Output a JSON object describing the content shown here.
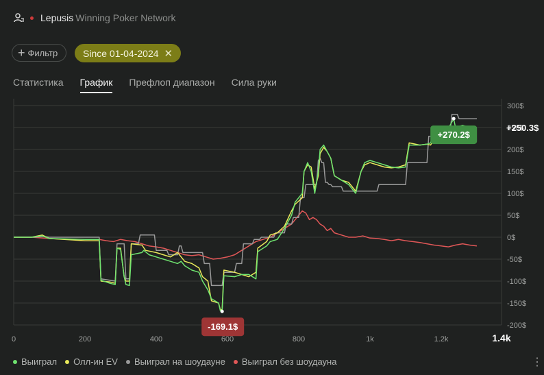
{
  "header": {
    "player": "Lepusis",
    "network": "Winning Poker Network"
  },
  "filter": {
    "add_label": "Фильтр",
    "date_chip": "Since 01-04-2024"
  },
  "tabs": [
    {
      "label": "Статистика"
    },
    {
      "label": "График"
    },
    {
      "label": "Префлоп диапазон"
    },
    {
      "label": "Сила руки"
    }
  ],
  "colors": {
    "won": "#6fe36f",
    "allin_ev": "#e8e85a",
    "showdown": "#9a9a9a",
    "non_showdown": "#e05757",
    "positive_badge": "#3f8f43",
    "negative_badge": "#9e3535"
  },
  "icons": {
    "player": "user-switch-icon",
    "more": "vertical-dots-icon"
  },
  "chart_data": {
    "type": "line",
    "xlim": [
      0,
      1400
    ],
    "ylim": [
      -200,
      300
    ],
    "x_ticks": [
      "0",
      "200",
      "400",
      "600",
      "800",
      "1k",
      "1.2k",
      "1.4k"
    ],
    "y_ticks": [
      "300$",
      "250$",
      "200$",
      "150$",
      "100$",
      "50$",
      "0$",
      "-50$",
      "-100$",
      "-150$",
      "-200$"
    ],
    "annotations": {
      "max_label": "+270.2$",
      "min_label": "-169.1$",
      "final_label": "+250.3$"
    },
    "series": [
      {
        "name": "Выиграл",
        "key": "won",
        "points": [
          [
            0,
            0
          ],
          [
            50,
            0
          ],
          [
            80,
            3
          ],
          [
            100,
            -3
          ],
          [
            200,
            -5
          ],
          [
            240,
            -5
          ],
          [
            245,
            -98
          ],
          [
            270,
            -105
          ],
          [
            285,
            -108
          ],
          [
            290,
            -25
          ],
          [
            300,
            -28
          ],
          [
            310,
            -90
          ],
          [
            315,
            -108
          ],
          [
            325,
            -110
          ],
          [
            330,
            -40
          ],
          [
            360,
            -35
          ],
          [
            365,
            -30
          ],
          [
            380,
            -40
          ],
          [
            400,
            -45
          ],
          [
            420,
            -50
          ],
          [
            440,
            -55
          ],
          [
            460,
            -60
          ],
          [
            470,
            -55
          ],
          [
            480,
            -65
          ],
          [
            500,
            -75
          ],
          [
            520,
            -80
          ],
          [
            530,
            -100
          ],
          [
            545,
            -120
          ],
          [
            555,
            -140
          ],
          [
            575,
            -150
          ],
          [
            580,
            -168
          ],
          [
            585,
            -169
          ],
          [
            590,
            -88
          ],
          [
            620,
            -90
          ],
          [
            640,
            -85
          ],
          [
            660,
            -85
          ],
          [
            680,
            -95
          ],
          [
            685,
            -33
          ],
          [
            710,
            -20
          ],
          [
            720,
            -10
          ],
          [
            740,
            -5
          ],
          [
            760,
            20
          ],
          [
            780,
            50
          ],
          [
            790,
            80
          ],
          [
            810,
            100
          ],
          [
            815,
            150
          ],
          [
            825,
            170
          ],
          [
            835,
            150
          ],
          [
            845,
            100
          ],
          [
            855,
            150
          ],
          [
            860,
            200
          ],
          [
            870,
            210
          ],
          [
            880,
            195
          ],
          [
            890,
            180
          ],
          [
            900,
            140
          ],
          [
            920,
            130
          ],
          [
            940,
            120
          ],
          [
            950,
            110
          ],
          [
            960,
            100
          ],
          [
            975,
            150
          ],
          [
            985,
            170
          ],
          [
            1000,
            175
          ],
          [
            1020,
            170
          ],
          [
            1040,
            165
          ],
          [
            1060,
            160
          ],
          [
            1080,
            158
          ],
          [
            1100,
            160
          ],
          [
            1110,
            210
          ],
          [
            1140,
            210
          ],
          [
            1160,
            212
          ],
          [
            1170,
            215
          ],
          [
            1180,
            240
          ],
          [
            1200,
            245
          ],
          [
            1220,
            248
          ],
          [
            1235,
            270
          ],
          [
            1240,
            250
          ],
          [
            1260,
            255
          ],
          [
            1280,
            250
          ],
          [
            1300,
            250
          ]
        ]
      },
      {
        "name": "Олл-ин EV",
        "key": "allin_ev",
        "points": [
          [
            0,
            0
          ],
          [
            50,
            0
          ],
          [
            80,
            5
          ],
          [
            100,
            -3
          ],
          [
            200,
            -8
          ],
          [
            240,
            -8
          ],
          [
            245,
            -100
          ],
          [
            270,
            -102
          ],
          [
            285,
            -105
          ],
          [
            290,
            -25
          ],
          [
            300,
            -25
          ],
          [
            310,
            -90
          ],
          [
            315,
            -100
          ],
          [
            325,
            -100
          ],
          [
            330,
            -15
          ],
          [
            360,
            -18
          ],
          [
            370,
            -30
          ],
          [
            400,
            -35
          ],
          [
            420,
            -40
          ],
          [
            440,
            -45
          ],
          [
            460,
            -35
          ],
          [
            480,
            -55
          ],
          [
            500,
            -60
          ],
          [
            520,
            -70
          ],
          [
            530,
            -90
          ],
          [
            545,
            -100
          ],
          [
            555,
            -145
          ],
          [
            575,
            -150
          ],
          [
            580,
            -165
          ],
          [
            585,
            -165
          ],
          [
            590,
            -75
          ],
          [
            620,
            -80
          ],
          [
            640,
            -85
          ],
          [
            660,
            -90
          ],
          [
            680,
            -80
          ],
          [
            685,
            -25
          ],
          [
            710,
            -10
          ],
          [
            720,
            5
          ],
          [
            740,
            10
          ],
          [
            760,
            25
          ],
          [
            780,
            60
          ],
          [
            790,
            75
          ],
          [
            810,
            90
          ],
          [
            815,
            150
          ],
          [
            825,
            165
          ],
          [
            835,
            160
          ],
          [
            845,
            110
          ],
          [
            855,
            140
          ],
          [
            860,
            190
          ],
          [
            870,
            205
          ],
          [
            880,
            195
          ],
          [
            890,
            180
          ],
          [
            900,
            140
          ],
          [
            920,
            130
          ],
          [
            940,
            125
          ],
          [
            950,
            115
          ],
          [
            960,
            105
          ],
          [
            975,
            150
          ],
          [
            985,
            165
          ],
          [
            1000,
            170
          ],
          [
            1020,
            165
          ],
          [
            1040,
            160
          ],
          [
            1060,
            158
          ],
          [
            1080,
            160
          ],
          [
            1100,
            165
          ],
          [
            1110,
            215
          ],
          [
            1140,
            210
          ],
          [
            1160,
            212
          ],
          [
            1170,
            210
          ],
          [
            1180,
            222
          ],
          [
            1200,
            225
          ],
          [
            1220,
            228
          ],
          [
            1235,
            235
          ],
          [
            1240,
            228
          ],
          [
            1260,
            226
          ],
          [
            1280,
            225
          ],
          [
            1300,
            225
          ]
        ]
      },
      {
        "name": "Выиграл на шоудауне",
        "key": "showdown",
        "points": [
          [
            0,
            0
          ],
          [
            60,
            0
          ],
          [
            80,
            2
          ],
          [
            100,
            0
          ],
          [
            240,
            0
          ],
          [
            245,
            -95
          ],
          [
            285,
            -100
          ],
          [
            290,
            -15
          ],
          [
            310,
            -15
          ],
          [
            315,
            -95
          ],
          [
            325,
            -95
          ],
          [
            330,
            -15
          ],
          [
            350,
            -15
          ],
          [
            355,
            5
          ],
          [
            395,
            5
          ],
          [
            400,
            -30
          ],
          [
            430,
            -30
          ],
          [
            435,
            -40
          ],
          [
            460,
            -40
          ],
          [
            465,
            -20
          ],
          [
            470,
            -20
          ],
          [
            475,
            -35
          ],
          [
            530,
            -35
          ],
          [
            535,
            -60
          ],
          [
            550,
            -60
          ],
          [
            555,
            -110
          ],
          [
            585,
            -110
          ],
          [
            590,
            -80
          ],
          [
            620,
            -80
          ],
          [
            625,
            -60
          ],
          [
            640,
            -60
          ],
          [
            645,
            -15
          ],
          [
            670,
            -15
          ],
          [
            675,
            -5
          ],
          [
            690,
            -5
          ],
          [
            695,
            0
          ],
          [
            730,
            0
          ],
          [
            735,
            10
          ],
          [
            760,
            10
          ],
          [
            765,
            30
          ],
          [
            780,
            30
          ],
          [
            785,
            45
          ],
          [
            800,
            45
          ],
          [
            805,
            90
          ],
          [
            815,
            90
          ],
          [
            820,
            120
          ],
          [
            850,
            120
          ],
          [
            855,
            175
          ],
          [
            860,
            180
          ],
          [
            865,
            170
          ],
          [
            870,
            170
          ],
          [
            875,
            125
          ],
          [
            880,
            125
          ],
          [
            885,
            120
          ],
          [
            890,
            120
          ],
          [
            895,
            115
          ],
          [
            920,
            115
          ],
          [
            925,
            105
          ],
          [
            1020,
            105
          ],
          [
            1025,
            120
          ],
          [
            1100,
            120
          ],
          [
            1105,
            170
          ],
          [
            1160,
            170
          ],
          [
            1165,
            230
          ],
          [
            1190,
            230
          ],
          [
            1195,
            240
          ],
          [
            1225,
            240
          ],
          [
            1230,
            280
          ],
          [
            1245,
            280
          ],
          [
            1250,
            270
          ],
          [
            1300,
            270
          ]
        ]
      },
      {
        "name": "Выиграл без шоудауна",
        "key": "non_showdown",
        "points": [
          [
            0,
            0
          ],
          [
            50,
            0
          ],
          [
            100,
            -3
          ],
          [
            150,
            -5
          ],
          [
            200,
            -5
          ],
          [
            240,
            -5
          ],
          [
            260,
            -8
          ],
          [
            280,
            -10
          ],
          [
            300,
            -5
          ],
          [
            320,
            -8
          ],
          [
            340,
            -10
          ],
          [
            360,
            -15
          ],
          [
            380,
            -20
          ],
          [
            400,
            -22
          ],
          [
            420,
            -25
          ],
          [
            440,
            -30
          ],
          [
            460,
            -35
          ],
          [
            480,
            -40
          ],
          [
            500,
            -42
          ],
          [
            520,
            -40
          ],
          [
            540,
            -45
          ],
          [
            560,
            -50
          ],
          [
            580,
            -48
          ],
          [
            600,
            -45
          ],
          [
            620,
            -40
          ],
          [
            640,
            -30
          ],
          [
            660,
            -20
          ],
          [
            680,
            -10
          ],
          [
            700,
            -5
          ],
          [
            720,
            0
          ],
          [
            740,
            10
          ],
          [
            760,
            20
          ],
          [
            780,
            30
          ],
          [
            790,
            40
          ],
          [
            800,
            50
          ],
          [
            810,
            60
          ],
          [
            820,
            55
          ],
          [
            830,
            40
          ],
          [
            840,
            45
          ],
          [
            850,
            40
          ],
          [
            860,
            30
          ],
          [
            870,
            25
          ],
          [
            880,
            15
          ],
          [
            890,
            20
          ],
          [
            900,
            10
          ],
          [
            920,
            5
          ],
          [
            940,
            0
          ],
          [
            960,
            0
          ],
          [
            980,
            3
          ],
          [
            1000,
            -2
          ],
          [
            1020,
            -3
          ],
          [
            1040,
            -5
          ],
          [
            1060,
            -8
          ],
          [
            1080,
            -5
          ],
          [
            1100,
            -8
          ],
          [
            1120,
            -10
          ],
          [
            1140,
            -12
          ],
          [
            1160,
            -15
          ],
          [
            1180,
            -18
          ],
          [
            1200,
            -20
          ],
          [
            1220,
            -22
          ],
          [
            1240,
            -18
          ],
          [
            1260,
            -15
          ],
          [
            1280,
            -18
          ],
          [
            1300,
            -20
          ]
        ]
      }
    ]
  }
}
